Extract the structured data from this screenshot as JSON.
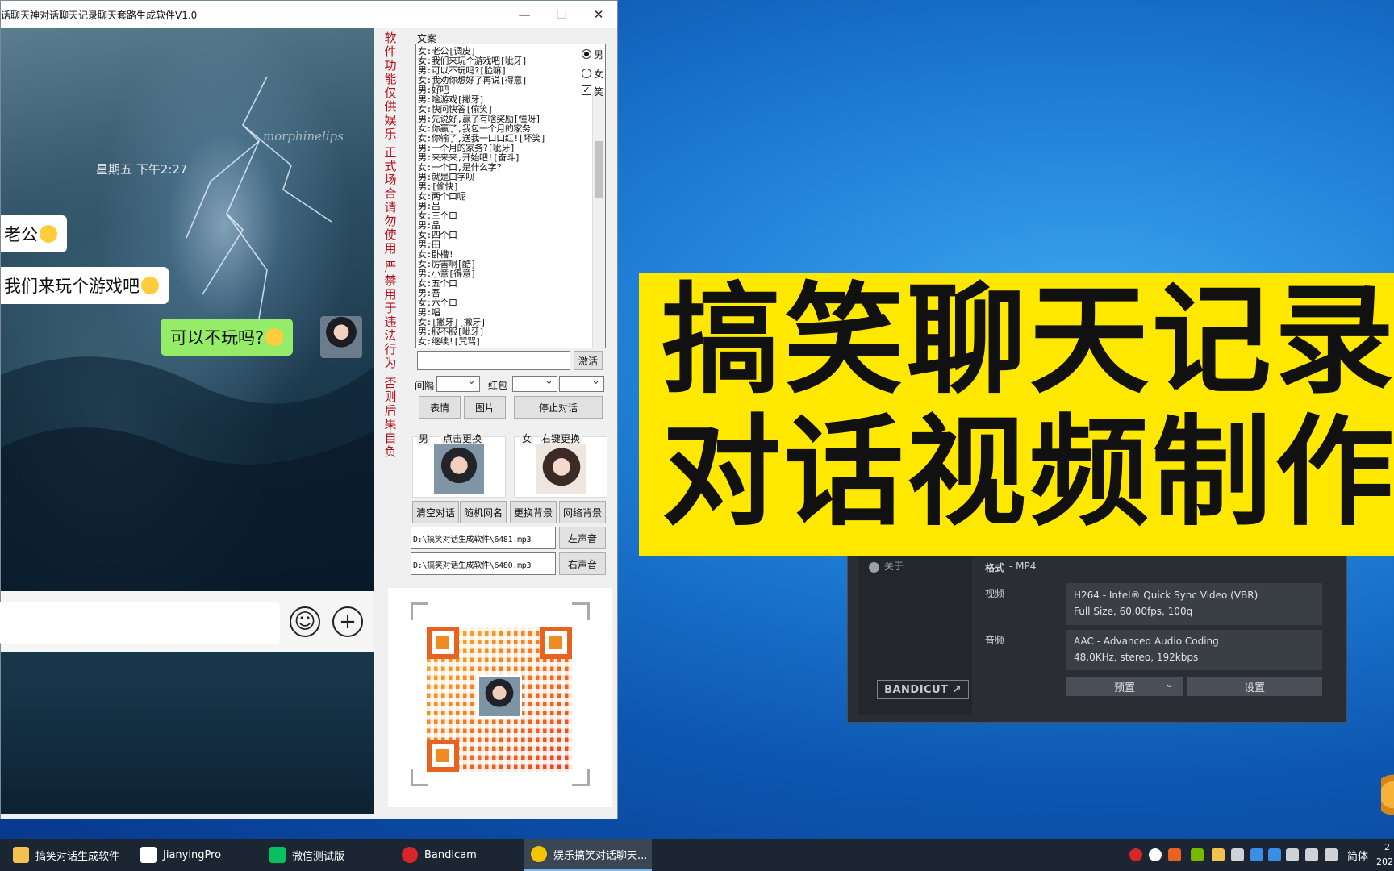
{
  "window": {
    "title": "话聊天神对话聊天记录聊天套路生成软件V1.0",
    "min": "—",
    "max": "☐",
    "close": "✕"
  },
  "chat": {
    "watermark": "morphinelips",
    "time": "星期五 下午2:27",
    "messages": [
      {
        "side": "left",
        "text": "老公"
      },
      {
        "side": "left",
        "text": "我们来玩个游戏吧"
      },
      {
        "side": "right",
        "text": "可以不玩吗?"
      }
    ],
    "emoji_icon": "☺",
    "plus_icon": "+"
  },
  "notices": [
    "软件功能仅供娱乐",
    "正式场合请勿使用",
    "严禁用于违法行为",
    "否则后果自负"
  ],
  "script": {
    "label": "文案",
    "lines": [
      "女:老公[调皮]",
      "女:我们来玩个游戏吧[呲牙]",
      "男:可以不玩吗?[脸嘛]",
      "女:我劝你想好了再说[得意]",
      "男:好吧",
      "男:啥游戏[撇牙]",
      "女:快问快答[偷笑]",
      "男:先说好,赢了有啥奖励[憧呀]",
      "女:你赢了,我包一个月的家务",
      "女:你输了,送我一口口红![坏笑]",
      "男:一个月的家务?[呲牙]",
      "男:来来来,开始吧![奋斗]",
      "女:一个口,是什么字?",
      "男:就是口字呗",
      "男:[偷快]",
      "女:两个口呢",
      "男:吕",
      "女:三个口",
      "男:品",
      "女:四个口",
      "男:田",
      "女:卧槽!",
      "女:厉害啊[酷]",
      "男:小意[得意]",
      "女:五个口",
      "男:吾",
      "女:六个口",
      "男:唱",
      "女:[撇牙][撇牙]",
      "男:服不服[呲牙]",
      "女:继续![咒骂]"
    ],
    "gender_male": "男",
    "gender_female": "女",
    "laugh": "笑",
    "check_mark": "✓"
  },
  "controls": {
    "activate_button": "激活",
    "interval_label": "间隔",
    "redpacket_label": "红包",
    "emoji_button": "表情",
    "image_button": "图片",
    "stop_button": "停止对话",
    "male_label": "男",
    "male_hint": "点击更换",
    "female_label": "女",
    "female_hint": "右键更换",
    "clear_button": "清空对话",
    "random_name_button": "随机网名",
    "change_bg_button": "更换背景",
    "web_bg_button": "网络背景",
    "left_audio_path": "D:\\搞笑对话生成软件\\6481.mp3",
    "right_audio_path": "D:\\搞笑对话生成软件\\6480.mp3",
    "left_audio_button": "左声音",
    "right_audio_button": "右声音"
  },
  "banner": {
    "line1": "搞笑聊天记录",
    "line2": "对话视频制作"
  },
  "bandicut": {
    "about": "关于",
    "about_icon": "i",
    "format_label": "格式",
    "format_value": "- MP4",
    "video_label": "视频",
    "video_line1": "H264 - Intel® Quick Sync Video (VBR)",
    "video_line2": "Full Size, 60.00fps, 100q",
    "audio_label": "音频",
    "audio_line1": "AAC - Advanced Audio Coding",
    "audio_line2": "48.0KHz, stereo, 192kbps",
    "logo": "BANDICUT ↗",
    "preset_button": "预置",
    "preset_arrow": "⌄",
    "settings_button": "设置"
  },
  "taskbar": {
    "items": [
      {
        "label": "搞笑对话生成软件",
        "color": "#f2c14e"
      },
      {
        "label": "JianyingPro",
        "color": "#ffffff"
      },
      {
        "label": "微信测试版",
        "color": "#07c160"
      },
      {
        "label": "Bandicam",
        "color": "#d7262b"
      },
      {
        "label": "娱乐搞笑对话聊天...",
        "color": "#f5c400"
      }
    ],
    "ime": "简体",
    "clock_time": "2",
    "clock_date": "202"
  },
  "colors": {
    "banner_bg": "#ffe800",
    "notice_red": "#b1101b",
    "bubble_green": "#95ec69"
  }
}
